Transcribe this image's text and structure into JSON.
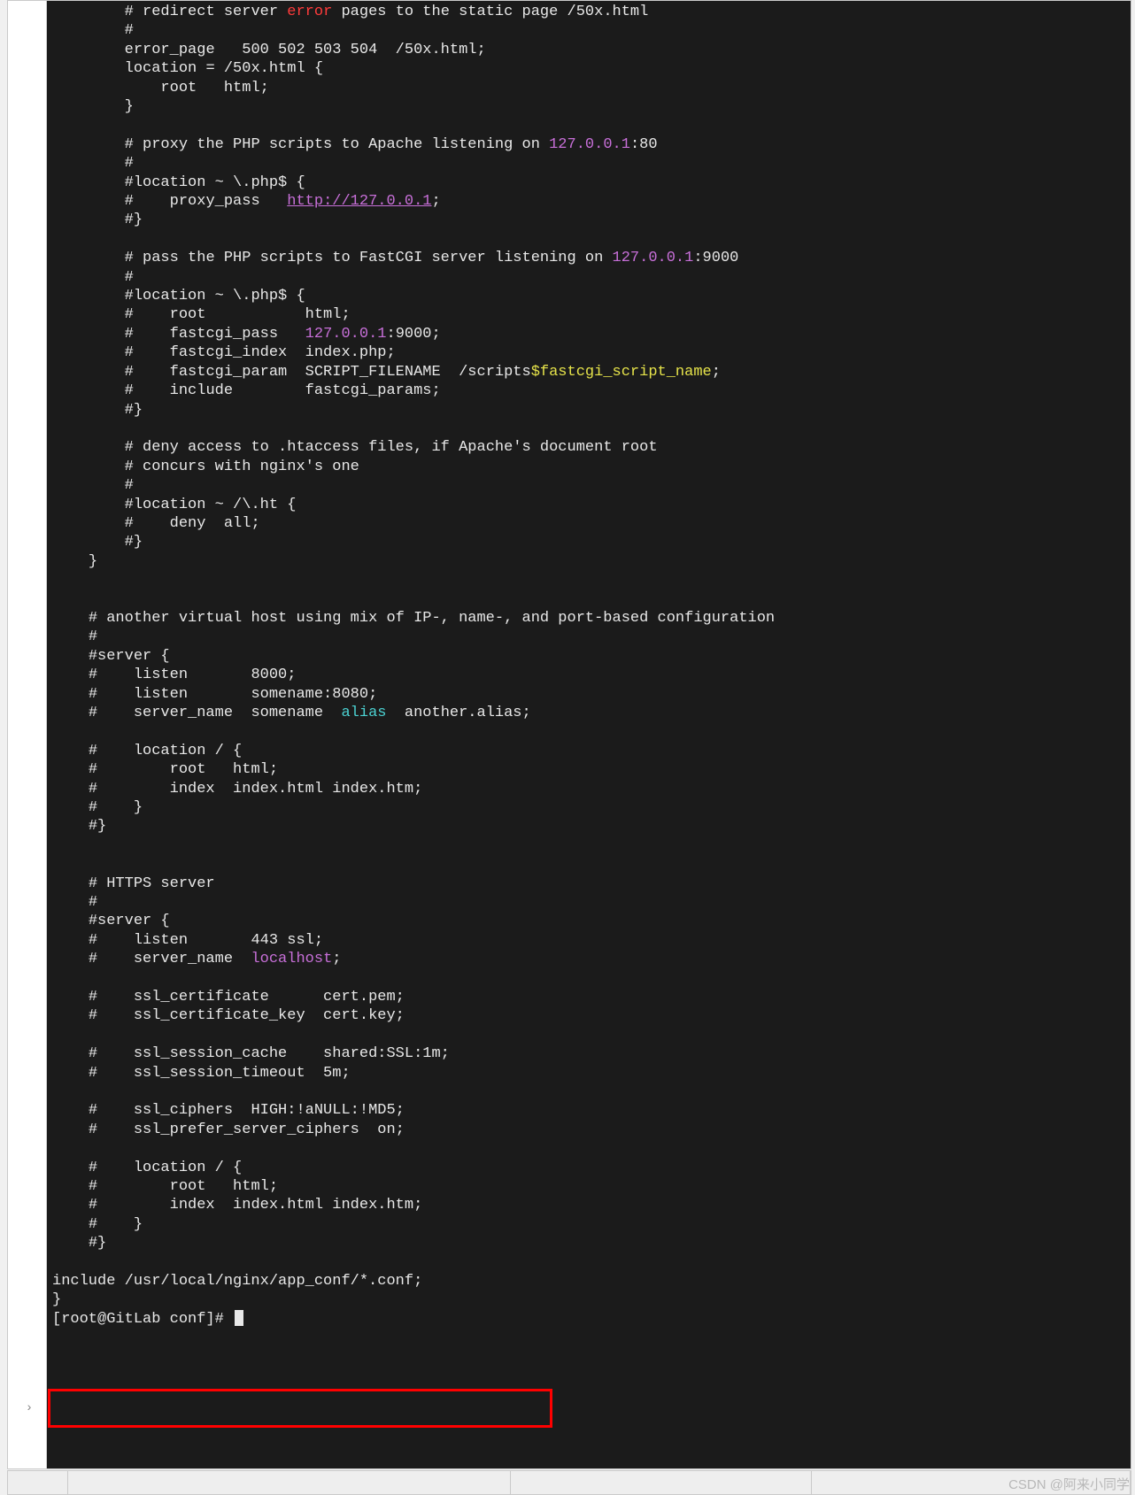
{
  "watermark": "CSDN @阿来小同学",
  "prompt": "[root@GitLab conf]# ",
  "colors": {
    "red": "#ff3b3b",
    "purple": "#c76fd8",
    "cyan": "#4bd2d2",
    "yellow": "#e6e34a",
    "bg": "#1b1b1b",
    "fg": "#e8e8e8"
  },
  "highlighted_line": "include /usr/local/nginx/app_conf/*.conf;",
  "lines": [
    {
      "indent": 8,
      "segs": [
        {
          "t": "# redirect server "
        },
        {
          "t": "error",
          "c": "red"
        },
        {
          "t": " pages to the static page /50x.html"
        }
      ]
    },
    {
      "indent": 8,
      "segs": [
        {
          "t": "#"
        }
      ]
    },
    {
      "indent": 8,
      "segs": [
        {
          "t": "error_page   500 502 503 504  /50x.html;"
        }
      ]
    },
    {
      "indent": 8,
      "segs": [
        {
          "t": "location = /50x.html {"
        }
      ]
    },
    {
      "indent": 8,
      "segs": [
        {
          "t": "    root   html;"
        }
      ]
    },
    {
      "indent": 8,
      "segs": [
        {
          "t": "}"
        }
      ]
    },
    {
      "indent": 0,
      "segs": [
        {
          "t": ""
        }
      ]
    },
    {
      "indent": 8,
      "segs": [
        {
          "t": "# proxy the PHP scripts to Apache listening on "
        },
        {
          "t": "127.0.0.1",
          "c": "purple"
        },
        {
          "t": ":80"
        }
      ]
    },
    {
      "indent": 8,
      "segs": [
        {
          "t": "#"
        }
      ]
    },
    {
      "indent": 8,
      "segs": [
        {
          "t": "#location ~ \\.php$ {"
        }
      ]
    },
    {
      "indent": 8,
      "segs": [
        {
          "t": "#    proxy_pass   "
        },
        {
          "t": "http://127.0.0.1",
          "c": "purple",
          "u": true
        },
        {
          "t": ";"
        }
      ]
    },
    {
      "indent": 8,
      "segs": [
        {
          "t": "#}"
        }
      ]
    },
    {
      "indent": 0,
      "segs": [
        {
          "t": ""
        }
      ]
    },
    {
      "indent": 8,
      "segs": [
        {
          "t": "# pass the PHP scripts to FastCGI server listening on "
        },
        {
          "t": "127.0.0.1",
          "c": "purple"
        },
        {
          "t": ":9000"
        }
      ]
    },
    {
      "indent": 8,
      "segs": [
        {
          "t": "#"
        }
      ]
    },
    {
      "indent": 8,
      "segs": [
        {
          "t": "#location ~ \\.php$ {"
        }
      ]
    },
    {
      "indent": 8,
      "segs": [
        {
          "t": "#    root           html;"
        }
      ]
    },
    {
      "indent": 8,
      "segs": [
        {
          "t": "#    fastcgi_pass   "
        },
        {
          "t": "127.0.0.1",
          "c": "purple"
        },
        {
          "t": ":9000;"
        }
      ]
    },
    {
      "indent": 8,
      "segs": [
        {
          "t": "#    fastcgi_index  index.php;"
        }
      ]
    },
    {
      "indent": 8,
      "segs": [
        {
          "t": "#    fastcgi_param  SCRIPT_FILENAME  /scripts"
        },
        {
          "t": "$fastcgi_script_name",
          "c": "yellow"
        },
        {
          "t": ";"
        }
      ]
    },
    {
      "indent": 8,
      "segs": [
        {
          "t": "#    include        fastcgi_params;"
        }
      ]
    },
    {
      "indent": 8,
      "segs": [
        {
          "t": "#}"
        }
      ]
    },
    {
      "indent": 0,
      "segs": [
        {
          "t": ""
        }
      ]
    },
    {
      "indent": 8,
      "segs": [
        {
          "t": "# deny access to .htaccess files, if Apache's document root"
        }
      ]
    },
    {
      "indent": 8,
      "segs": [
        {
          "t": "# concurs with nginx's one"
        }
      ]
    },
    {
      "indent": 8,
      "segs": [
        {
          "t": "#"
        }
      ]
    },
    {
      "indent": 8,
      "segs": [
        {
          "t": "#location ~ /\\.ht {"
        }
      ]
    },
    {
      "indent": 8,
      "segs": [
        {
          "t": "#    deny  all;"
        }
      ]
    },
    {
      "indent": 8,
      "segs": [
        {
          "t": "#}"
        }
      ]
    },
    {
      "indent": 4,
      "segs": [
        {
          "t": "}"
        }
      ]
    },
    {
      "indent": 0,
      "segs": [
        {
          "t": ""
        }
      ]
    },
    {
      "indent": 0,
      "segs": [
        {
          "t": ""
        }
      ]
    },
    {
      "indent": 4,
      "segs": [
        {
          "t": "# another virtual host using mix of IP-, name-, and port-based configuration"
        }
      ]
    },
    {
      "indent": 4,
      "segs": [
        {
          "t": "#"
        }
      ]
    },
    {
      "indent": 4,
      "segs": [
        {
          "t": "#server {"
        }
      ]
    },
    {
      "indent": 4,
      "segs": [
        {
          "t": "#    listen       8000;"
        }
      ]
    },
    {
      "indent": 4,
      "segs": [
        {
          "t": "#    listen       somename:8080;"
        }
      ]
    },
    {
      "indent": 4,
      "segs": [
        {
          "t": "#    server_name  somename  "
        },
        {
          "t": "alias",
          "c": "cyan"
        },
        {
          "t": "  another.alias;"
        }
      ]
    },
    {
      "indent": 0,
      "segs": [
        {
          "t": ""
        }
      ]
    },
    {
      "indent": 4,
      "segs": [
        {
          "t": "#    location / {"
        }
      ]
    },
    {
      "indent": 4,
      "segs": [
        {
          "t": "#        root   html;"
        }
      ]
    },
    {
      "indent": 4,
      "segs": [
        {
          "t": "#        index  index.html index.htm;"
        }
      ]
    },
    {
      "indent": 4,
      "segs": [
        {
          "t": "#    }"
        }
      ]
    },
    {
      "indent": 4,
      "segs": [
        {
          "t": "#}"
        }
      ]
    },
    {
      "indent": 0,
      "segs": [
        {
          "t": ""
        }
      ]
    },
    {
      "indent": 0,
      "segs": [
        {
          "t": ""
        }
      ]
    },
    {
      "indent": 4,
      "segs": [
        {
          "t": "# HTTPS server"
        }
      ]
    },
    {
      "indent": 4,
      "segs": [
        {
          "t": "#"
        }
      ]
    },
    {
      "indent": 4,
      "segs": [
        {
          "t": "#server {"
        }
      ]
    },
    {
      "indent": 4,
      "segs": [
        {
          "t": "#    listen       443 ssl;"
        }
      ]
    },
    {
      "indent": 4,
      "segs": [
        {
          "t": "#    server_name  "
        },
        {
          "t": "localhost",
          "c": "purple"
        },
        {
          "t": ";"
        }
      ]
    },
    {
      "indent": 0,
      "segs": [
        {
          "t": ""
        }
      ]
    },
    {
      "indent": 4,
      "segs": [
        {
          "t": "#    ssl_certificate      cert.pem;"
        }
      ]
    },
    {
      "indent": 4,
      "segs": [
        {
          "t": "#    ssl_certificate_key  cert.key;"
        }
      ]
    },
    {
      "indent": 0,
      "segs": [
        {
          "t": ""
        }
      ]
    },
    {
      "indent": 4,
      "segs": [
        {
          "t": "#    ssl_session_cache    shared:SSL:1m;"
        }
      ]
    },
    {
      "indent": 4,
      "segs": [
        {
          "t": "#    ssl_session_timeout  5m;"
        }
      ]
    },
    {
      "indent": 0,
      "segs": [
        {
          "t": ""
        }
      ]
    },
    {
      "indent": 4,
      "segs": [
        {
          "t": "#    ssl_ciphers  HIGH:!aNULL:!MD5;"
        }
      ]
    },
    {
      "indent": 4,
      "segs": [
        {
          "t": "#    ssl_prefer_server_ciphers  on;"
        }
      ]
    },
    {
      "indent": 0,
      "segs": [
        {
          "t": ""
        }
      ]
    },
    {
      "indent": 4,
      "segs": [
        {
          "t": "#    location / {"
        }
      ]
    },
    {
      "indent": 4,
      "segs": [
        {
          "t": "#        root   html;"
        }
      ]
    },
    {
      "indent": 4,
      "segs": [
        {
          "t": "#        index  index.html index.htm;"
        }
      ]
    },
    {
      "indent": 4,
      "segs": [
        {
          "t": "#    }"
        }
      ]
    },
    {
      "indent": 4,
      "segs": [
        {
          "t": "#}"
        }
      ]
    },
    {
      "indent": 0,
      "segs": [
        {
          "t": ""
        }
      ]
    },
    {
      "indent": 0,
      "segs": [
        {
          "t": "include /usr/local/nginx/app_conf/*.conf;"
        }
      ]
    },
    {
      "indent": 0,
      "segs": [
        {
          "t": "}"
        }
      ]
    }
  ],
  "tabs_widths": [
    68,
    500,
    340,
    360
  ]
}
